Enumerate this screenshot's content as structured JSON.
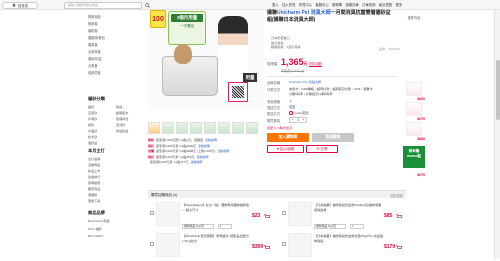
{
  "topbar": {
    "logo_label": "回首頁",
    "search_placeholder": "請輸入關鍵字搜尋商品",
    "links": [
      "登入",
      "加入會員",
      "會員中心",
      "客服中心",
      "購物車",
      "追蹤清單",
      "訂單查詢",
      "最近瀏覽",
      "更多"
    ]
  },
  "sidebar": {
    "left_col": [
      "狗狗用品",
      "狗乾糧",
      "貓乾糧",
      "貓罐頭/餐包",
      "貓零食",
      "犬用零食",
      "貓砂/砂盆",
      "犬零食",
      "保健營養"
    ],
    "section_label": "貓砂分類",
    "cat_col1": [
      "礦砂",
      "豆腐砂",
      "木屑砂",
      "紙砂",
      "水晶砂",
      "松木砂",
      "貓砂盆"
    ],
    "cat_col2": [
      "除臭",
      "超級吸水",
      "環保材質",
      "天然砂",
      "除臭砂盆"
    ],
    "section2_label": "本月主打",
    "promo_items": [
      "主打品牌",
      "活動專區",
      "新品上市",
      "熱賣排行",
      "限時優惠",
      "獨家商品",
      "滿額贈",
      "限量下殺"
    ],
    "brand_label": "商品品牌",
    "brand_items": [
      "EverClean 藍鑽",
      "KCG 貓砂",
      "DR.GLEFY"
    ]
  },
  "gallery": {
    "badge": "100",
    "promo_title": "3個月用量",
    "promo_sub": "一次購足",
    "brand_tag": "用量"
  },
  "offers": [
    {
      "tag": "限時",
      "text": "單筆滿1,000元贈 ms點1元；滿額送",
      "link": "活動說明"
    },
    {
      "tag": "現折",
      "text": "單筆滿2,000元折 ms點2000元",
      "link": "活動說明"
    },
    {
      "tag": "加購",
      "text": "單筆滿3,000元折 ms點3000元 (上限1,000元)",
      "link": "活動說明"
    },
    {
      "tag": "現折",
      "text": "單筆滿3,000元折 ms點250元",
      "link": "活動說明"
    },
    {
      "tag": "",
      "text": "單筆滿5,000元折 ms點777元",
      "link": "活動說明"
    }
  ],
  "product": {
    "title_prefix": "嬌聯",
    "title_highlight": "Unicharm Pet 消臭大師",
    "title_rest": "一月間消臭抗菌雙層貓砂盆組(嬌聯日本消臭大師)",
    "bullets": [
      "日本原裝進口",
      "強力消臭",
      "超級吸收，1週不用換"
    ],
    "code": "品號：1084179",
    "price_label": "促銷價",
    "price": "1,365",
    "price_unit": "元",
    "price_note": "折扣活動",
    "orig_price": "市售價 1,530 元",
    "attrs": [
      {
        "label": "品牌名稱",
        "value": "Unicharm Pet 消臭大師"
      },
      {
        "label": "付款方式",
        "value": "信用卡｜ATM轉帳｜超商付款｜超商取貨付款｜ATM｜銀聯卡"
      },
      {
        "label": "",
        "value": "分期0利率 / 分期最高12期0利率"
      },
      {
        "label": "商品規格",
        "value": "小"
      },
      {
        "label": "運送方式",
        "value": "宅配"
      },
      {
        "label": "配送方式",
        "value": "momo宅配"
      },
      {
        "label": "購買數量",
        "value": "1"
      }
    ],
    "delivery_note": "宅配 6 小時內出貨",
    "btn_cart": "加入購物車",
    "btn_buy": "直接購買",
    "btn_track": "加入追蹤",
    "btn_share": "分享"
  },
  "right_rail": {
    "head": "推薦商品",
    "prices": [
      "$400",
      "$279",
      "$369",
      "$279"
    ],
    "banner_line1": "跨年購",
    "banner_line2": "momo點"
  },
  "recommend": {
    "title": "購買加購商品 (4)",
    "more": "回到頂部",
    "items": [
      {
        "text": "【HappyMama】好大一點！寵物專用寵物貓抓板 — 超大尺寸",
        "price": "$23",
        "select": "寵物用品 1kg/包",
        "qty": "1"
      },
      {
        "text": "【日本礦業】貓咪除臭去臭膏3(100g/包)貓咪保養用除臭膏",
        "price": "$85",
        "select": "寵物用品 1kg/包",
        "qty": "1"
      },
      {
        "text": "【ADVANCE 愛德萊斯】狗專屬方 (絕對品質配方 1.5kg)幼犬",
        "price": "$399",
        "select": "",
        "qty": "1"
      },
      {
        "text": "【日本礦業】貓咪除臭去臭膏包裝(80g)*5入中盒貓咪除臭",
        "price": "$179",
        "select": "",
        "qty": "1"
      }
    ]
  },
  "colors": {
    "accent": "#e6003d",
    "cart": "#ff7300",
    "link": "#2a62c9",
    "rail_banner": "#1a8f3a"
  }
}
